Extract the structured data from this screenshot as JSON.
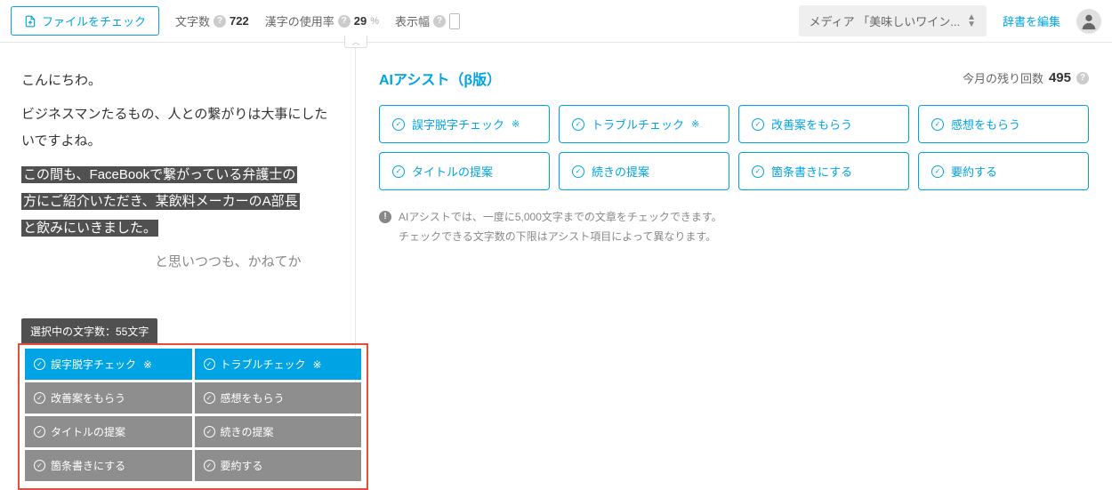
{
  "toolbar": {
    "file_check": "ファイルをチェック",
    "char_count_label": "文字数",
    "char_count_value": "722",
    "kanji_label": "漢字の使用率",
    "kanji_value": "29",
    "kanji_unit": "%",
    "display_width_label": "表示幅",
    "media_select": "メディア 「美味しいワイン...",
    "dict_edit": "辞書を編集"
  },
  "document": {
    "p1": "こんにちわ。",
    "p2": "ビジネスマンたるもの、人との繋がりは大事にしたいですよね。",
    "sel_line1": "この間も、FaceBookで繋がっている弁護士の",
    "sel_line2": "方にご紹介いただき、某飲料メーカーのA部長",
    "sel_line3": "と飲みにいきました。",
    "after_sel_tail": "と思いつつも、かねてか"
  },
  "selection": {
    "count_text": "選択中の文字数：55文字"
  },
  "float_buttons": [
    {
      "label": "誤字脱字チェック",
      "ast": "※",
      "style": "blue"
    },
    {
      "label": "トラブルチェック",
      "ast": "※",
      "style": "blue"
    },
    {
      "label": "改善案をもらう",
      "ast": "",
      "style": "gray"
    },
    {
      "label": "感想をもらう",
      "ast": "",
      "style": "gray"
    },
    {
      "label": "タイトルの提案",
      "ast": "",
      "style": "gray"
    },
    {
      "label": "続きの提案",
      "ast": "",
      "style": "gray"
    },
    {
      "label": "箇条書きにする",
      "ast": "",
      "style": "gray"
    },
    {
      "label": "要約する",
      "ast": "",
      "style": "gray"
    }
  ],
  "ai": {
    "title": "AIアシスト（β版）",
    "remaining_label": "今月の残り回数",
    "remaining_value": "495",
    "buttons": [
      {
        "label": "誤字脱字チェック",
        "ast": "※"
      },
      {
        "label": "トラブルチェック",
        "ast": "※"
      },
      {
        "label": "改善案をもらう",
        "ast": ""
      },
      {
        "label": "感想をもらう",
        "ast": ""
      },
      {
        "label": "タイトルの提案",
        "ast": ""
      },
      {
        "label": "続きの提案",
        "ast": ""
      },
      {
        "label": "箇条書きにする",
        "ast": ""
      },
      {
        "label": "要約する",
        "ast": ""
      }
    ],
    "note_line1": "AIアシストでは、一度に5,000文字までの文章をチェックできます。",
    "note_line2": "チェックできる文字数の下限はアシスト項目によって異なります。"
  }
}
